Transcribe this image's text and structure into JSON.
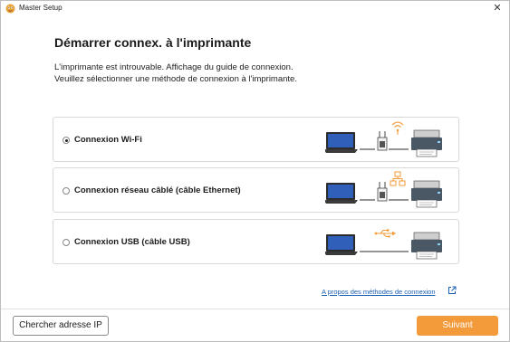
{
  "window": {
    "title": "Master Setup",
    "close_glyph": "✕"
  },
  "main": {
    "heading": "Démarrer connex. à l'imprimante",
    "description_line1": "L'imprimante est introuvable. Affichage du guide de connexion.",
    "description_line2": "Veuillez sélectionner une méthode de connexion à l'imprimante."
  },
  "options": [
    {
      "label": "Connexion Wi-Fi",
      "selected": true,
      "icon": "wifi-signal-icon"
    },
    {
      "label": "Connexion réseau câblé (câble Ethernet)",
      "selected": false,
      "icon": "network-icon"
    },
    {
      "label": "Connexion USB (câble USB)",
      "selected": false,
      "icon": "usb-icon"
    }
  ],
  "links": {
    "about_methods": "A propos des méthodes de connexion"
  },
  "footer": {
    "search_ip_label": "Chercher adresse IP",
    "next_label": "Suivant"
  },
  "colors": {
    "accent_orange": "#f39a3a",
    "link_blue": "#1a5fb4"
  }
}
